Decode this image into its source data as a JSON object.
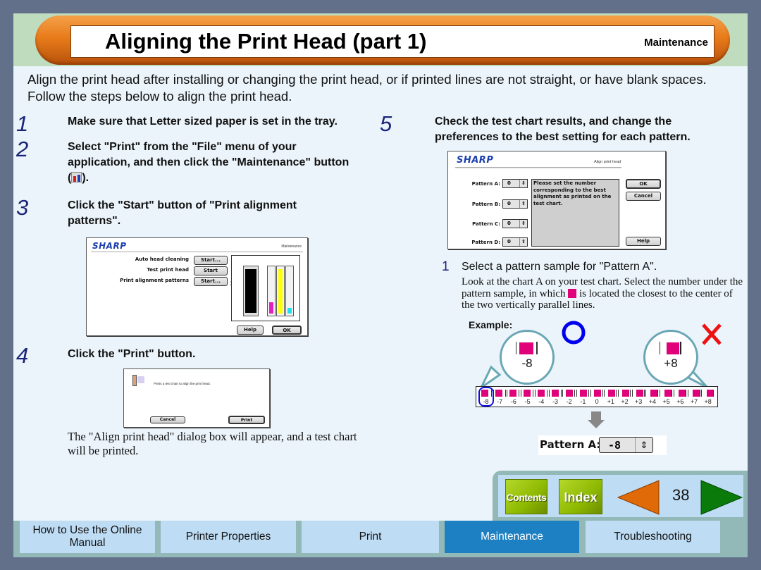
{
  "header": {
    "title": "Aligning the Print Head (part 1)",
    "section": "Maintenance"
  },
  "intro": "Align the print head after installing or changing the print head, or if printed lines are not straight, or have blank spaces. Follow the steps below to align the print head.",
  "steps": [
    {
      "number": "1",
      "text": "Make sure that Letter sized paper is set in the tray."
    },
    {
      "number": "2",
      "text_before": "Select \"Print\" from the \"File\" menu of your application, and then click the \"Maintenance\" button (",
      "text_after": ")."
    },
    {
      "number": "3",
      "text": "Click the \"Start\" button of \"Print alignment patterns\"."
    },
    {
      "number": "4",
      "text": "Click the \"Print\" button.",
      "note": "The \"Align print head\" dialog box will appear, and a test chart will be printed."
    },
    {
      "number": "5",
      "text": "Check the test chart results, and change the preferences to the best setting for each pattern."
    }
  ],
  "maintenance_dialog": {
    "brand": "SHARP",
    "title": "Maintenance",
    "rows": [
      {
        "label": "Auto head cleaning",
        "button": "Start..."
      },
      {
        "label": "Test print head",
        "button": "Start"
      },
      {
        "label": "Print alignment patterns",
        "button": "Start..."
      }
    ],
    "ink_levels": {
      "black": 1.0,
      "magenta": 0.25,
      "yellow": 1.0,
      "cyan": 0.12
    },
    "help": "Help",
    "ok": "OK"
  },
  "print_dialog": {
    "message": "Prints a test chart to align the print head.",
    "cancel": "Cancel",
    "print": "Print"
  },
  "align_dialog": {
    "brand": "SHARP",
    "title": "Align print head",
    "patterns": [
      {
        "label": "Pattern A:",
        "value": "0"
      },
      {
        "label": "Pattern B:",
        "value": "0"
      },
      {
        "label": "Pattern C:",
        "value": "0"
      },
      {
        "label": "Pattern D:",
        "value": "0"
      }
    ],
    "message": "Please set the number corresponding to the best alignment as printed on the test chart.",
    "ok": "OK",
    "cancel": "Cancel",
    "help": "Help"
  },
  "substep": {
    "number": "1",
    "title": "Select a pattern sample for \"Pattern A\".",
    "body_before": "Look at the chart A on your test chart. Select the number under the pattern sample, in which ",
    "body_after": " is located the closest to the center of the two vertically parallel lines."
  },
  "example": {
    "label": "Example:",
    "good_value": "-8",
    "bad_value": "+8",
    "scale_labels": [
      "-8",
      "-7",
      "-6",
      "-5",
      "-4",
      "-3",
      "-2",
      "-1",
      "0",
      "+1",
      "+2",
      "+3",
      "+4",
      "+5",
      "+6",
      "+7",
      "+8"
    ],
    "selected": "-8",
    "result_label": "Pattern A:",
    "result_value": "-8"
  },
  "nav": {
    "contents": "Contents",
    "index": "Index",
    "page_number": "38"
  },
  "bottom_tabs": [
    {
      "label": "How to Use the Online Manual",
      "active": false
    },
    {
      "label": "Printer Properties",
      "active": false
    },
    {
      "label": "Print",
      "active": false
    },
    {
      "label": "Maintenance",
      "active": true
    },
    {
      "label": "Troubleshooting",
      "active": false
    }
  ]
}
